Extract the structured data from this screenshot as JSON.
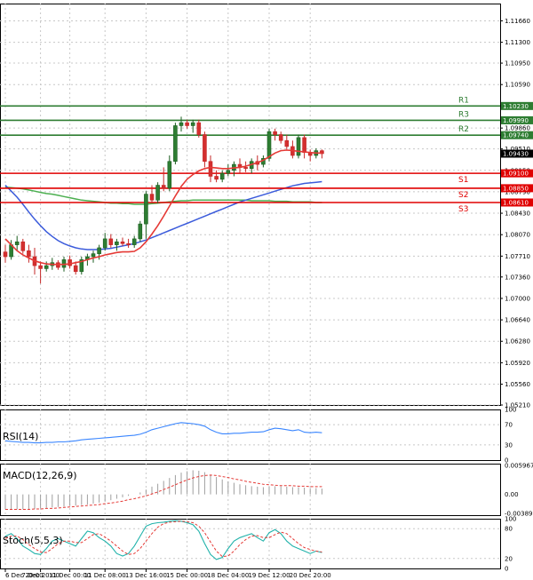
{
  "chart_data": [
    {
      "type": "candlestick",
      "panel": "price",
      "ylim": [
        1.0521,
        1.1195
      ],
      "y_ticks": [
        "1.11660",
        "1.11300",
        "1.10950",
        "1.10590",
        "1.10230",
        "1.09860",
        "1.09510",
        "1.09150",
        "1.08790",
        "1.08430",
        "1.08070",
        "1.07710",
        "1.07360",
        "1.07000",
        "1.06640",
        "1.06280",
        "1.05920",
        "1.05560",
        "1.05210"
      ],
      "x_ticks": [
        "6 Dec 20:00",
        "7 Dec 20:00",
        "11 Dec 00:00",
        "11 Dec 08:00",
        "13 Dec 16:00",
        "15 Dec 00:00",
        "18 Dec 04:00",
        "19 Dec 12:00",
        "20 Dec 20:00"
      ],
      "current_price": "1.09430",
      "levels": [
        {
          "name": "R3",
          "value": 1.0999,
          "label": "1.09990",
          "color": "#2e7d32"
        },
        {
          "name": "R2",
          "value": 1.0974,
          "label": "1.09740",
          "color": "#2e7d32"
        },
        {
          "name": "R1",
          "value": 1.1023,
          "label": "1.10230",
          "color": "#2e7d32"
        },
        {
          "name": "S1",
          "value": 1.091,
          "label": "1.09100",
          "color": "#e00000"
        },
        {
          "name": "S2",
          "value": 1.0885,
          "label": "1.08850",
          "color": "#e00000"
        },
        {
          "name": "S3",
          "value": 1.0861,
          "label": "1.08610",
          "color": "#e00000"
        }
      ],
      "candles": [
        [
          1.0778,
          1.079,
          1.076,
          1.077
        ],
        [
          1.077,
          1.0798,
          1.0765,
          1.079
        ],
        [
          1.079,
          1.0805,
          1.078,
          1.0795
        ],
        [
          1.0795,
          1.08,
          1.0775,
          1.078
        ],
        [
          1.078,
          1.079,
          1.076,
          1.077
        ],
        [
          1.077,
          1.0785,
          1.074,
          1.0755
        ],
        [
          1.0755,
          1.0762,
          1.0725,
          1.075
        ],
        [
          1.075,
          1.0762,
          1.0745,
          1.0755
        ],
        [
          1.0755,
          1.0768,
          1.0748,
          1.076
        ],
        [
          1.076,
          1.0764,
          1.0748,
          1.0752
        ],
        [
          1.0752,
          1.077,
          1.0745,
          1.0765
        ],
        [
          1.0765,
          1.0772,
          1.075,
          1.0755
        ],
        [
          1.0755,
          1.0762,
          1.074,
          1.0745
        ],
        [
          1.0745,
          1.077,
          1.074,
          1.0765
        ],
        [
          1.0765,
          1.0775,
          1.0755,
          1.077
        ],
        [
          1.077,
          1.078,
          1.076,
          1.0775
        ],
        [
          1.0775,
          1.079,
          1.0765,
          1.0785
        ],
        [
          1.0785,
          1.081,
          1.078,
          1.08
        ],
        [
          1.08,
          1.0808,
          1.0785,
          1.079
        ],
        [
          1.079,
          1.08,
          1.078,
          1.0795
        ],
        [
          1.0795,
          1.0802,
          1.0788,
          1.0792
        ],
        [
          1.0792,
          1.08,
          1.0785,
          1.079
        ],
        [
          1.079,
          1.0805,
          1.0785,
          1.08
        ],
        [
          1.08,
          1.083,
          1.0795,
          1.0825
        ],
        [
          1.0825,
          1.088,
          1.08,
          1.0875
        ],
        [
          1.0875,
          1.089,
          1.086,
          1.0865
        ],
        [
          1.0865,
          1.0895,
          1.086,
          1.089
        ],
        [
          1.089,
          1.092,
          1.088,
          1.0885
        ],
        [
          1.0885,
          1.094,
          1.088,
          1.093
        ],
        [
          1.093,
          1.0995,
          1.0925,
          1.099
        ],
        [
          1.099,
          1.1005,
          1.098,
          1.0995
        ],
        [
          1.0995,
          1.1,
          1.0985,
          1.099
        ],
        [
          1.099,
          1.1,
          1.0978,
          1.0995
        ],
        [
          1.0995,
          1.1,
          1.097,
          1.0975
        ],
        [
          1.0975,
          1.098,
          1.092,
          1.093
        ],
        [
          1.093,
          1.094,
          1.0895,
          1.0905
        ],
        [
          1.0905,
          1.0915,
          1.0895,
          1.09
        ],
        [
          1.09,
          1.0915,
          1.0895,
          1.091
        ],
        [
          1.091,
          1.0925,
          1.0905,
          1.0915
        ],
        [
          1.0915,
          1.093,
          1.0905,
          1.0925
        ],
        [
          1.0925,
          1.0935,
          1.091,
          1.092
        ],
        [
          1.092,
          1.093,
          1.0912,
          1.0918
        ],
        [
          1.0918,
          1.0935,
          1.091,
          1.093
        ],
        [
          1.093,
          1.094,
          1.0915,
          1.0925
        ],
        [
          1.0925,
          1.094,
          1.092,
          1.0935
        ],
        [
          1.0935,
          1.0985,
          1.093,
          1.098
        ],
        [
          1.098,
          1.0985,
          1.0965,
          1.0975
        ],
        [
          1.0975,
          1.098,
          1.096,
          1.0965
        ],
        [
          1.0965,
          1.0975,
          1.095,
          1.0955
        ],
        [
          1.0955,
          1.0965,
          1.0935,
          1.094
        ],
        [
          1.094,
          1.0975,
          1.0935,
          1.097
        ],
        [
          1.097,
          1.0975,
          1.0935,
          1.0945
        ],
        [
          1.0945,
          1.095,
          1.093,
          1.094
        ],
        [
          1.094,
          1.0952,
          1.0935,
          1.0948
        ],
        [
          1.0948,
          1.095,
          1.0935,
          1.0943
        ]
      ],
      "ma_fast": [
        1.08,
        1.079,
        1.078,
        1.0773,
        1.0768,
        1.0763,
        1.076,
        1.0758,
        1.0757,
        1.0757,
        1.0757,
        1.0758,
        1.076,
        1.0762,
        1.0765,
        1.0768,
        1.077,
        1.0773,
        1.0775,
        1.0777,
        1.0778,
        1.0778,
        1.0779,
        1.0785,
        1.0795,
        1.0808,
        1.0822,
        1.0838,
        1.0855,
        1.0872,
        1.0888,
        1.09,
        1.0908,
        1.0914,
        1.0918,
        1.092,
        1.0919,
        1.0918,
        1.0918,
        1.0919,
        1.092,
        1.0922,
        1.0925,
        1.0928,
        1.0932,
        1.0938,
        1.0944,
        1.0948,
        1.0949,
        1.0948,
        1.0947,
        1.0946,
        1.0945,
        1.0944,
        1.0944
      ],
      "ma_mid": [
        1.089,
        1.088,
        1.087,
        1.0858,
        1.0845,
        1.0833,
        1.0822,
        1.0812,
        1.0804,
        1.0797,
        1.0792,
        1.0788,
        1.0785,
        1.0783,
        1.0782,
        1.0782,
        1.0782,
        1.0783,
        1.0784,
        1.0786,
        1.0788,
        1.079,
        1.0792,
        1.0795,
        1.0798,
        1.0802,
        1.0806,
        1.081,
        1.0814,
        1.0818,
        1.0822,
        1.0826,
        1.083,
        1.0834,
        1.0838,
        1.0842,
        1.0846,
        1.085,
        1.0854,
        1.0858,
        1.0862,
        1.0865,
        1.0868,
        1.0871,
        1.0874,
        1.0877,
        1.088,
        1.0883,
        1.0886,
        1.0889,
        1.0891,
        1.0893,
        1.0894,
        1.0895,
        1.0896
      ],
      "ma_slow": [
        1.0887,
        1.0886,
        1.0885,
        1.0884,
        1.0882,
        1.088,
        1.0878,
        1.0876,
        1.0875,
        1.0873,
        1.0871,
        1.0869,
        1.0867,
        1.0865,
        1.0864,
        1.0863,
        1.0862,
        1.0861,
        1.086,
        1.086,
        1.0859,
        1.0859,
        1.0858,
        1.0858,
        1.0858,
        1.0859,
        1.086,
        1.0861,
        1.0862,
        1.0863,
        1.0864,
        1.0864,
        1.0865,
        1.0865,
        1.0865,
        1.0865,
        1.0865,
        1.0865,
        1.0865,
        1.0865,
        1.0865,
        1.0865,
        1.0864,
        1.0864,
        1.0864,
        1.0864,
        1.0863,
        1.0863,
        1.0863,
        1.0862,
        1.0862,
        1.0862,
        1.0862,
        1.0861,
        1.0861
      ]
    },
    {
      "type": "line",
      "panel": "rsi",
      "title": "RSI(14)",
      "ylim": [
        0,
        100
      ],
      "y_ticks": [
        "100",
        "70",
        "30",
        "0"
      ],
      "values": [
        38,
        37,
        36,
        35,
        35,
        34,
        34,
        35,
        35,
        36,
        36,
        37,
        38,
        40,
        41,
        42,
        43,
        44,
        45,
        46,
        47,
        48,
        49,
        51,
        55,
        60,
        63,
        66,
        69,
        72,
        74,
        73,
        72,
        70,
        67,
        60,
        55,
        52,
        52,
        53,
        53,
        54,
        55,
        55,
        56,
        60,
        63,
        62,
        60,
        58,
        60,
        55,
        54,
        55,
        54
      ]
    },
    {
      "type": "bar",
      "panel": "macd",
      "title": "MACD(12,26,9)",
      "ylim": [
        -0.003896,
        0.005967
      ],
      "y_ticks": [
        "0.005967",
        "0.00",
        "-0.003896"
      ],
      "histogram": [
        -0.003,
        -0.0031,
        -0.0031,
        -0.0031,
        -0.003,
        -0.003,
        -0.0029,
        -0.0028,
        -0.0027,
        -0.0026,
        -0.0025,
        -0.0024,
        -0.0023,
        -0.0022,
        -0.0021,
        -0.0019,
        -0.0017,
        -0.0015,
        -0.0012,
        -0.0009,
        -0.0006,
        -0.0003,
        0.0,
        0.0004,
        0.001,
        0.0016,
        0.0022,
        0.0028,
        0.0034,
        0.004,
        0.0045,
        0.0048,
        0.005,
        0.0049,
        0.0046,
        0.0041,
        0.0036,
        0.0031,
        0.0027,
        0.0024,
        0.0021,
        0.0019,
        0.0017,
        0.0016,
        0.0015,
        0.0016,
        0.0017,
        0.0017,
        0.0016,
        0.0015,
        0.0015,
        0.0014,
        0.0013,
        0.0013,
        0.0012
      ],
      "signal": [
        -0.0031,
        -0.0031,
        -0.0031,
        -0.0031,
        -0.0031,
        -0.003,
        -0.003,
        -0.0029,
        -0.0029,
        -0.0028,
        -0.0027,
        -0.0026,
        -0.0025,
        -0.0024,
        -0.0023,
        -0.0022,
        -0.0021,
        -0.0019,
        -0.0018,
        -0.0016,
        -0.0014,
        -0.0011,
        -0.0009,
        -0.0006,
        -0.0003,
        0.0001,
        0.0005,
        0.001,
        0.0015,
        0.002,
        0.0025,
        0.003,
        0.0034,
        0.0037,
        0.0039,
        0.004,
        0.0039,
        0.0037,
        0.0035,
        0.0032,
        0.003,
        0.0027,
        0.0025,
        0.0023,
        0.0021,
        0.002,
        0.0019,
        0.0018,
        0.0018,
        0.0018,
        0.0017,
        0.0017,
        0.0016,
        0.0016,
        0.0016
      ]
    },
    {
      "type": "line",
      "panel": "stoch",
      "title": "Stoch(5,5,3)",
      "ylim": [
        0,
        100
      ],
      "y_ticks": [
        "100",
        "80",
        "20",
        "0"
      ],
      "k": [
        65,
        70,
        60,
        45,
        38,
        30,
        28,
        40,
        55,
        60,
        55,
        50,
        45,
        60,
        75,
        72,
        62,
        55,
        45,
        30,
        25,
        30,
        45,
        65,
        85,
        90,
        92,
        93,
        95,
        96,
        95,
        92,
        88,
        75,
        50,
        28,
        18,
        22,
        40,
        55,
        62,
        66,
        70,
        62,
        55,
        72,
        78,
        70,
        55,
        45,
        40,
        35,
        30,
        35,
        32
      ],
      "d": [
        60,
        65,
        65,
        58,
        48,
        40,
        33,
        32,
        40,
        50,
        55,
        55,
        52,
        52,
        60,
        68,
        70,
        63,
        55,
        45,
        35,
        28,
        30,
        40,
        55,
        70,
        83,
        90,
        93,
        94,
        95,
        94,
        92,
        85,
        72,
        53,
        35,
        24,
        25,
        35,
        48,
        58,
        65,
        66,
        62,
        62,
        68,
        73,
        70,
        60,
        50,
        42,
        38,
        35,
        33
      ]
    }
  ]
}
